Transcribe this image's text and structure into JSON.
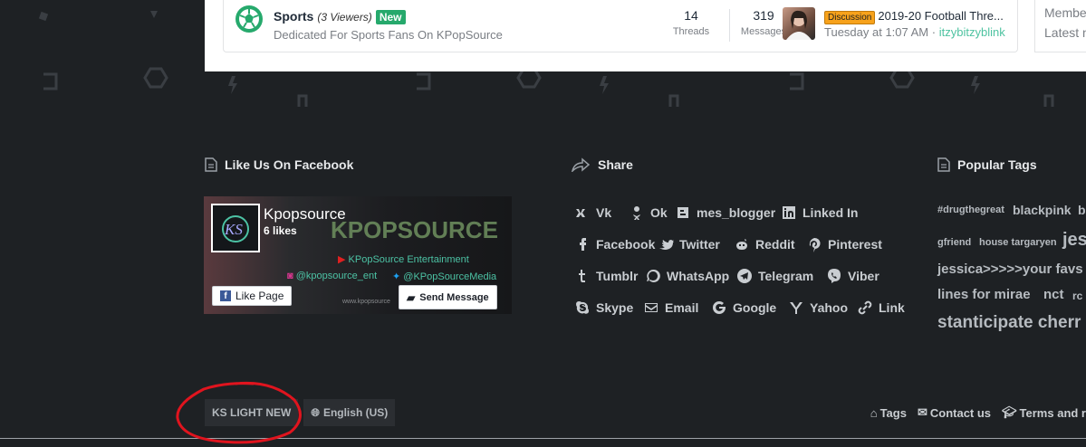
{
  "forum": {
    "node": {
      "title": "Sports",
      "viewers": "(3 Viewers)",
      "badge": "New",
      "description": "Dedicated For Sports Fans On KPopSource",
      "threads_count": "14",
      "threads_label": "Threads",
      "messages_count": "319",
      "messages_label": "Messages"
    },
    "last_post": {
      "prefix": "Discussion",
      "title": "2019-20 Football Thre...",
      "time": "Tuesday at 1:07 AM",
      "separator": "·",
      "user": "itzybitzyblink"
    },
    "side": {
      "line1": "Membe",
      "line2": "Latest n"
    }
  },
  "facebook": {
    "heading": "Like Us On Facebook",
    "page_name": "Kpopsource",
    "likes": "6 likes",
    "brand": "KPOPSOURCE",
    "entertainment": "KPopSource Entertainment",
    "instagram": "@kpopsource_ent",
    "twitter": "@KPopSourceMedia",
    "url": "www.kpopsource",
    "like_button": "Like Page",
    "message_button": "Send Message"
  },
  "share": {
    "heading": "Share",
    "items": [
      {
        "label": "Vk",
        "icon": "vk-icon"
      },
      {
        "label": "Ok",
        "icon": "odnoklassniki-icon"
      },
      {
        "label": "mes_blogger",
        "icon": "blogger-icon"
      },
      {
        "label": "Linked In",
        "icon": "linkedin-icon"
      },
      {
        "label": "Facebook",
        "icon": "facebook-icon"
      },
      {
        "label": "Twitter",
        "icon": "twitter-icon"
      },
      {
        "label": "Reddit",
        "icon": "reddit-icon"
      },
      {
        "label": "Pinterest",
        "icon": "pinterest-icon"
      },
      {
        "label": "Tumblr",
        "icon": "tumblr-icon"
      },
      {
        "label": "WhatsApp",
        "icon": "whatsapp-icon"
      },
      {
        "label": "Telegram",
        "icon": "telegram-icon"
      },
      {
        "label": "Viber",
        "icon": "viber-icon"
      },
      {
        "label": "Skype",
        "icon": "skype-icon"
      },
      {
        "label": "Email",
        "icon": "email-icon"
      },
      {
        "label": "Google",
        "icon": "google-icon"
      },
      {
        "label": "Yahoo",
        "icon": "yahoo-icon"
      },
      {
        "label": "Link",
        "icon": "link-icon"
      }
    ]
  },
  "tags": {
    "heading": "Popular Tags",
    "items": [
      {
        "label": "#drugthegreat"
      },
      {
        "label": "blackpink"
      },
      {
        "label": "b"
      },
      {
        "label": "gfriend"
      },
      {
        "label": "house targaryen"
      },
      {
        "label": "jes"
      },
      {
        "label": "jessica>>>>>your favs"
      },
      {
        "label": "lines for mirae"
      },
      {
        "label": "nct"
      },
      {
        "label": "rc"
      },
      {
        "label": "stanticipate cherr"
      }
    ]
  },
  "footer": {
    "style_label": "KS LIGHT NEW",
    "language_label": "English (US)",
    "links": [
      "Tags",
      "Contact us",
      "Terms and r"
    ]
  },
  "colors": {
    "background": "#1e2124",
    "accent": "#26a96c",
    "annotation": "#e0141e"
  }
}
